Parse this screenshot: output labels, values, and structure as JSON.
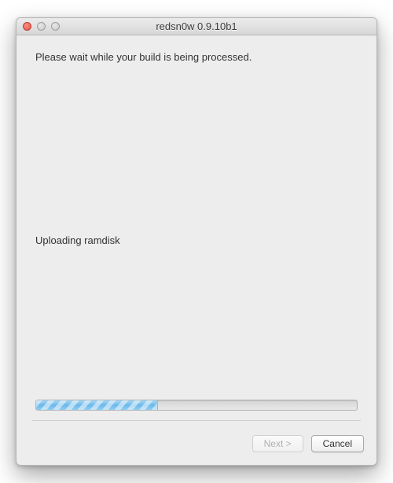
{
  "window": {
    "title": "redsn0w 0.9.10b1"
  },
  "content": {
    "instruction": "Please wait while your build is being processed.",
    "status": "Uploading ramdisk"
  },
  "progress": {
    "percent": 38
  },
  "footer": {
    "next_label": "Next >",
    "cancel_label": "Cancel"
  }
}
